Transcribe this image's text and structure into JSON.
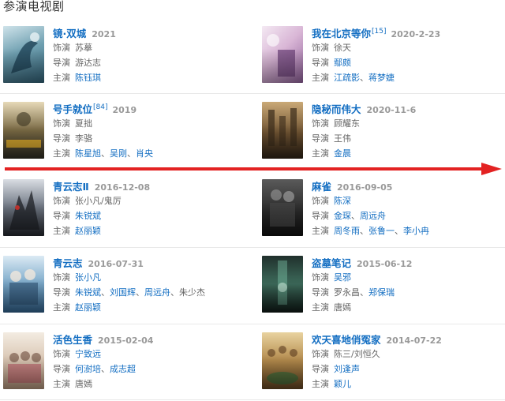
{
  "section_title": "参演电视剧",
  "colors": {
    "link": "#136ec2",
    "arrow": "#e32222",
    "muted": "#999999"
  },
  "cards": [
    {
      "title": "镜·双城",
      "sup": "",
      "date": "2021",
      "rows": [
        {
          "role": "饰演",
          "names": [
            {
              "t": "苏摹",
              "link": false
            }
          ]
        },
        {
          "role": "导演",
          "names": [
            {
              "t": "游达志",
              "link": false
            }
          ]
        },
        {
          "role": "主演",
          "names": [
            {
              "t": "陈钰琪",
              "link": true
            }
          ]
        }
      ]
    },
    {
      "title": "我在北京等你",
      "sup": "[15]",
      "date": "2020-2-23",
      "rows": [
        {
          "role": "饰演",
          "names": [
            {
              "t": "徐天",
              "link": false
            }
          ]
        },
        {
          "role": "导演",
          "names": [
            {
              "t": "鄢颇",
              "link": true
            }
          ]
        },
        {
          "role": "主演",
          "names": [
            {
              "t": "江疏影",
              "link": true
            },
            {
              "t": "蒋梦婕",
              "link": true
            }
          ]
        }
      ]
    },
    {
      "title": "号手就位",
      "sup": "[84]",
      "date": "2019",
      "rows": [
        {
          "role": "饰演",
          "names": [
            {
              "t": "夏拙",
              "link": false
            }
          ]
        },
        {
          "role": "导演",
          "names": [
            {
              "t": "李骆",
              "link": false
            }
          ]
        },
        {
          "role": "主演",
          "names": [
            {
              "t": "陈星旭",
              "link": true
            },
            {
              "t": "吴刚",
              "link": true
            },
            {
              "t": "肖央",
              "link": true
            }
          ]
        }
      ]
    },
    {
      "title": "隐秘而伟大",
      "sup": "",
      "date": "2020-11-6",
      "rows": [
        {
          "role": "饰演",
          "names": [
            {
              "t": "顾耀东",
              "link": false
            }
          ]
        },
        {
          "role": "导演",
          "names": [
            {
              "t": "王伟",
              "link": false
            }
          ]
        },
        {
          "role": "主演",
          "names": [
            {
              "t": "金晨",
              "link": true
            }
          ]
        }
      ]
    },
    {
      "title": "青云志Ⅱ",
      "sup": "",
      "date": "2016-12-08",
      "rows": [
        {
          "role": "饰演",
          "names": [
            {
              "t": "张小凡/鬼厉",
              "link": false
            }
          ]
        },
        {
          "role": "导演",
          "names": [
            {
              "t": "朱锐斌",
              "link": true
            }
          ]
        },
        {
          "role": "主演",
          "names": [
            {
              "t": "赵丽颖",
              "link": true
            }
          ]
        }
      ]
    },
    {
      "title": "麻雀",
      "sup": "",
      "date": "2016-09-05",
      "rows": [
        {
          "role": "饰演",
          "names": [
            {
              "t": "陈深",
              "link": true
            }
          ]
        },
        {
          "role": "导演",
          "names": [
            {
              "t": "金琛",
              "link": true
            },
            {
              "t": "周远舟",
              "link": true
            }
          ]
        },
        {
          "role": "主演",
          "names": [
            {
              "t": "周冬雨",
              "link": true
            },
            {
              "t": "张鲁一",
              "link": true
            },
            {
              "t": "李小冉",
              "link": true
            }
          ]
        }
      ]
    },
    {
      "title": "青云志",
      "sup": "",
      "date": "2016-07-31",
      "rows": [
        {
          "role": "饰演",
          "names": [
            {
              "t": "张小凡",
              "link": true
            }
          ]
        },
        {
          "role": "导演",
          "names": [
            {
              "t": "朱锐斌",
              "link": true
            },
            {
              "t": "刘国辉",
              "link": true
            },
            {
              "t": "周远舟",
              "link": true
            },
            {
              "t": "朱少杰",
              "link": false
            }
          ]
        },
        {
          "role": "主演",
          "names": [
            {
              "t": "赵丽颖",
              "link": true
            }
          ]
        }
      ]
    },
    {
      "title": "盗墓笔记",
      "sup": "",
      "date": "2015-06-12",
      "rows": [
        {
          "role": "饰演",
          "names": [
            {
              "t": "吴邪",
              "link": true
            }
          ]
        },
        {
          "role": "导演",
          "names": [
            {
              "t": "罗永昌",
              "link": false
            },
            {
              "t": "郑保瑞",
              "link": true
            }
          ]
        },
        {
          "role": "主演",
          "names": [
            {
              "t": "唐嫣",
              "link": false
            }
          ]
        }
      ]
    },
    {
      "title": "活色生香",
      "sup": "",
      "date": "2015-02-04",
      "rows": [
        {
          "role": "饰演",
          "names": [
            {
              "t": "宁致远",
              "link": true
            }
          ]
        },
        {
          "role": "导演",
          "names": [
            {
              "t": "何澍培",
              "link": true
            },
            {
              "t": "成志超",
              "link": true
            }
          ]
        },
        {
          "role": "主演",
          "names": [
            {
              "t": "唐嫣",
              "link": false
            }
          ]
        }
      ]
    },
    {
      "title": "欢天喜地俏冤家",
      "sup": "",
      "date": "2014-07-22",
      "rows": [
        {
          "role": "饰演",
          "names": [
            {
              "t": "陈三/刘恒久",
              "link": false
            }
          ]
        },
        {
          "role": "导演",
          "names": [
            {
              "t": "刘逢声",
              "link": true
            }
          ]
        },
        {
          "role": "主演",
          "names": [
            {
              "t": "颖儿",
              "link": true
            }
          ]
        }
      ]
    }
  ]
}
